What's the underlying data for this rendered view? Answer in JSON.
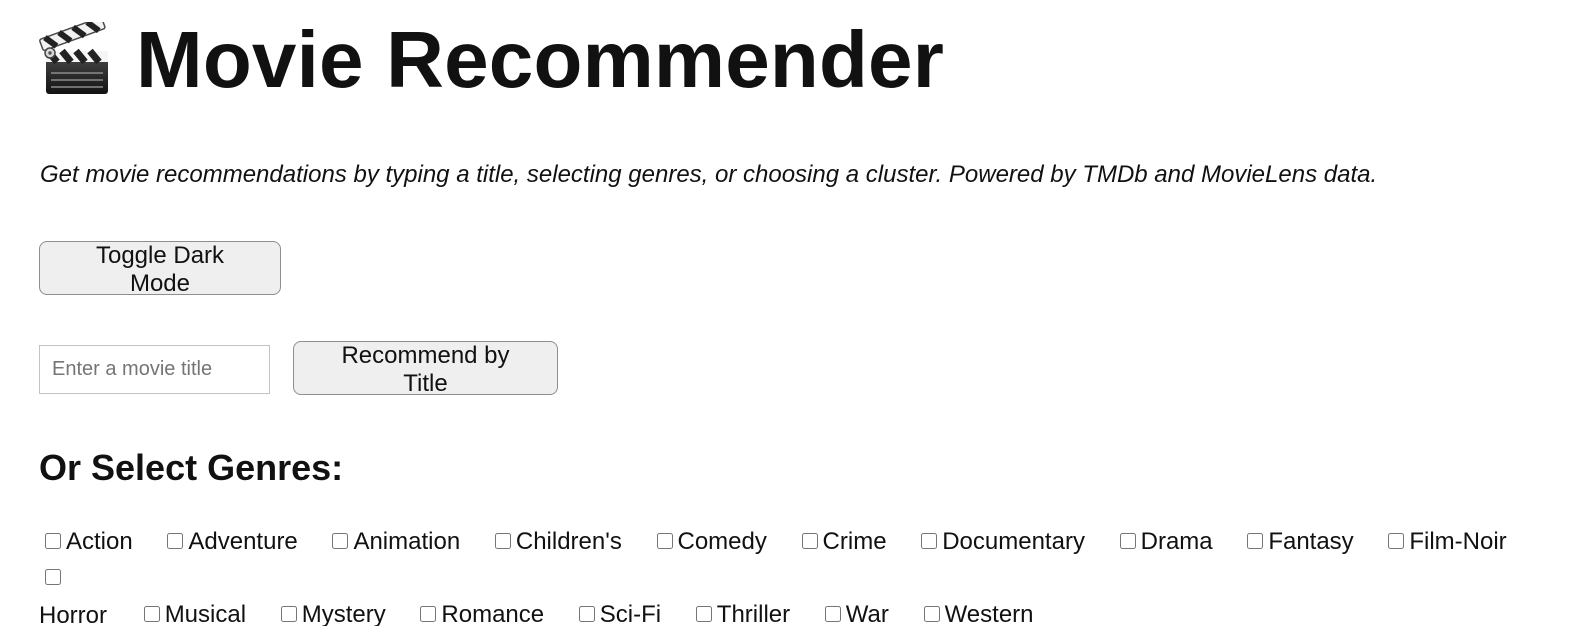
{
  "header": {
    "icon": "clapperboard-icon",
    "title": "Movie Recommender"
  },
  "intro": {
    "text": "Get movie recommendations by typing a title, selecting genres, or choosing a cluster. Powered by TMDb and MovieLens data."
  },
  "controls": {
    "toggle_dark_mode": "Toggle Dark Mode",
    "title_input": {
      "value": "",
      "placeholder": "Enter a movie title"
    },
    "recommend_by_title": "Recommend by Title"
  },
  "genres": {
    "heading": "Or Select Genres:",
    "items": [
      {
        "label": "Action",
        "checked": false
      },
      {
        "label": "Adventure",
        "checked": false
      },
      {
        "label": "Animation",
        "checked": false
      },
      {
        "label": "Children's",
        "checked": false
      },
      {
        "label": "Comedy",
        "checked": false
      },
      {
        "label": "Crime",
        "checked": false
      },
      {
        "label": "Documentary",
        "checked": false
      },
      {
        "label": "Drama",
        "checked": false
      },
      {
        "label": "Fantasy",
        "checked": false
      },
      {
        "label": "Film-Noir",
        "checked": false
      },
      {
        "label": "Horror",
        "checked": false
      },
      {
        "label": "Musical",
        "checked": false
      },
      {
        "label": "Mystery",
        "checked": false
      },
      {
        "label": "Romance",
        "checked": false
      },
      {
        "label": "Sci-Fi",
        "checked": false
      },
      {
        "label": "Thriller",
        "checked": false
      },
      {
        "label": "War",
        "checked": false
      },
      {
        "label": "Western",
        "checked": false
      }
    ]
  },
  "colors": {
    "text": "#111111",
    "button_background": "#efefef",
    "button_border": "#8e8e8e",
    "input_border": "#c3c3c3"
  }
}
